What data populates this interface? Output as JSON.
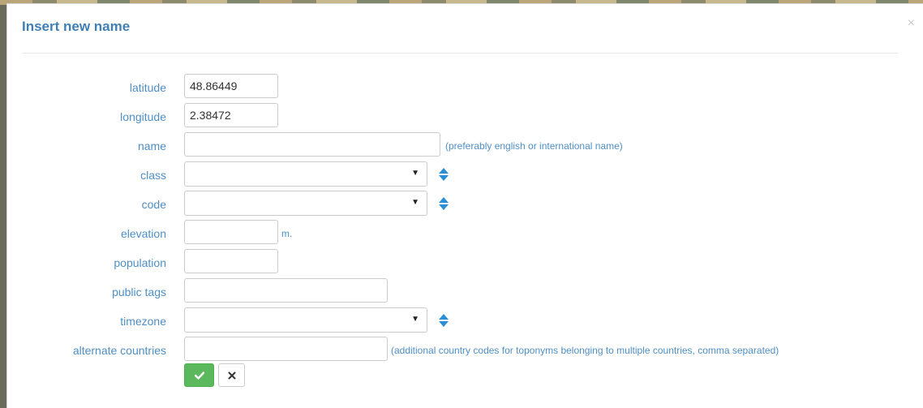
{
  "dialog": {
    "title": "Insert new name",
    "close_glyph": "×"
  },
  "form": {
    "latitude": {
      "label": "latitude",
      "value": "48.86449"
    },
    "longitude": {
      "label": "longitude",
      "value": "2.38472"
    },
    "name": {
      "label": "name",
      "value": "",
      "hint": "(preferably english or international name)"
    },
    "class": {
      "label": "class",
      "value": ""
    },
    "code": {
      "label": "code",
      "value": ""
    },
    "elevation": {
      "label": "elevation",
      "value": "",
      "unit": "m."
    },
    "population": {
      "label": "population",
      "value": ""
    },
    "public_tags": {
      "label": "public tags",
      "value": ""
    },
    "timezone": {
      "label": "timezone",
      "value": ""
    },
    "alternate_countries": {
      "label": "alternate countries",
      "value": "",
      "hint": "(additional country codes for toponyms belonging to multiple countries, comma separated)"
    }
  },
  "icons": {
    "caret": "caret-down-icon",
    "sort": "sort-icon",
    "ok": "check-icon",
    "cancel": "close-icon"
  },
  "colors": {
    "title": "#3f7fb5",
    "label": "#4f8fc4",
    "sort_icon": "#2a8fd6",
    "ok_button": "#5cb85c"
  }
}
